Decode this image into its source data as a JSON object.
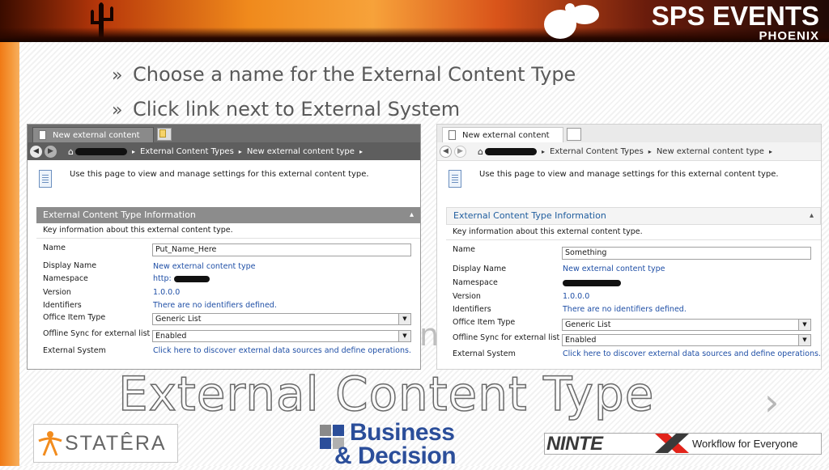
{
  "header": {
    "brand_title": "SPS EVENTS",
    "brand_subtitle": "PHOENIX"
  },
  "bullets": [
    {
      "marker": "»",
      "text": "Choose a name for the External Content Type"
    },
    {
      "marker": "»",
      "text": "Click link next to External System"
    }
  ],
  "panel_left": {
    "tab_label": "New external content type *",
    "breadcrumb": [
      "External Content Types",
      "New external content type"
    ],
    "info_text": "Use this page to view and manage settings for this external content type.",
    "section_title": "External Content Type Information",
    "section_desc": "Key information about this external content type.",
    "fields": {
      "name_label": "Name",
      "name_value": "Put_Name_Here",
      "display_name_label": "Display Name",
      "display_name_value": "New external content type",
      "namespace_label": "Namespace",
      "namespace_value": "http:",
      "version_label": "Version",
      "version_value": "1.0.0.0",
      "identifiers_label": "Identifiers",
      "identifiers_value": "There are no identifiers defined.",
      "office_item_type_label": "Office Item Type",
      "office_item_type_value": "Generic List",
      "offline_sync_label": "Offline Sync for external list",
      "offline_sync_value": "Enabled",
      "external_system_label": "External System",
      "external_system_value": "Click here to discover external data sources and define operations."
    }
  },
  "panel_right": {
    "tab_label": "New external content type *",
    "breadcrumb": [
      "External Content Types",
      "New external content type"
    ],
    "info_text": "Use this page to view and manage settings for this external content type.",
    "section_title": "External Content Type Information",
    "section_desc": "Key information about this external content type.",
    "fields": {
      "name_label": "Name",
      "name_value": "Something",
      "display_name_label": "Display Name",
      "display_name_value": "New external content type",
      "namespace_label": "Namespace",
      "version_label": "Version",
      "version_value": "1.0.0.0",
      "identifiers_label": "Identifiers",
      "identifiers_value": "There are no identifiers defined.",
      "office_item_type_label": "Office Item Type",
      "office_item_type_value": "Generic List",
      "offline_sync_label": "Offline Sync for external list",
      "offline_sync_value": "Enabled",
      "external_system_label": "External System",
      "external_system_value": "Click here to discover external data sources and define operations."
    }
  },
  "slide_title": "External Content Type",
  "next_chevron": "›",
  "faint_letter": "n",
  "footer": {
    "statera": "STATÊRA",
    "bd_line1": "Business",
    "bd_line2": "& Decision",
    "nintex": "NINTE",
    "nintex_tagline": "Workflow for Everyone"
  },
  "colors": {
    "link": "#1f4fa6",
    "bd_blue": "#2b4e9a",
    "accent_orange": "#f07a16"
  }
}
